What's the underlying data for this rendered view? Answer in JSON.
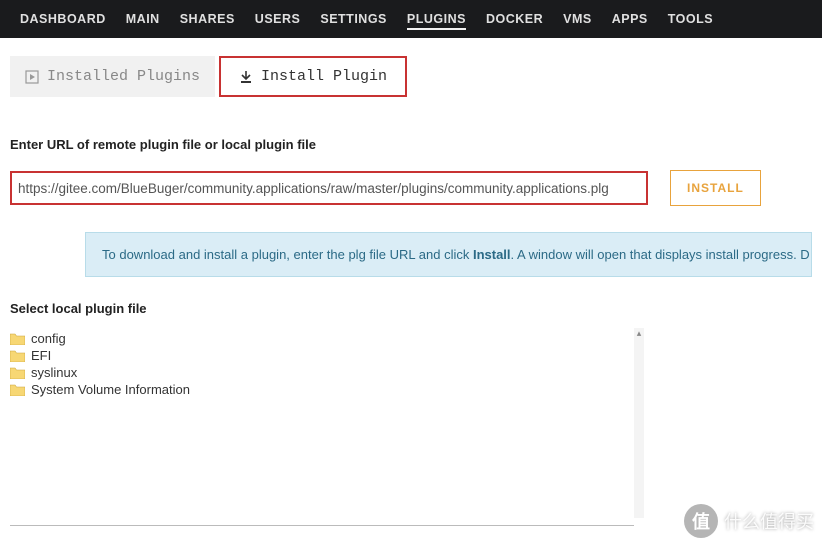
{
  "nav": {
    "items": [
      {
        "label": "DASHBOARD",
        "active": false
      },
      {
        "label": "MAIN",
        "active": false
      },
      {
        "label": "SHARES",
        "active": false
      },
      {
        "label": "USERS",
        "active": false
      },
      {
        "label": "SETTINGS",
        "active": false
      },
      {
        "label": "PLUGINS",
        "active": true
      },
      {
        "label": "DOCKER",
        "active": false
      },
      {
        "label": "VMS",
        "active": false
      },
      {
        "label": "APPS",
        "active": false
      },
      {
        "label": "TOOLS",
        "active": false
      }
    ]
  },
  "tabs": {
    "installed": {
      "label": "Installed Plugins"
    },
    "install": {
      "label": "Install Plugin"
    }
  },
  "form": {
    "url_label": "Enter URL of remote plugin file or local plugin file",
    "url_value": "https://gitee.com/BlueBuger/community.applications/raw/master/plugins/community.applications.plg",
    "install_button": "INSTALL"
  },
  "info": {
    "pre": "To download and install a plugin, enter the plg file URL and click ",
    "bold": "Install",
    "post": ". A window will open that displays install progress. D"
  },
  "filetree": {
    "label": "Select local plugin file",
    "items": [
      {
        "name": "config"
      },
      {
        "name": "EFI"
      },
      {
        "name": "syslinux"
      },
      {
        "name": "System Volume Information"
      }
    ]
  },
  "watermark": {
    "badge": "值",
    "text": "什么值得买"
  },
  "colors": {
    "highlight_red": "#c83232",
    "accent_orange": "#e8a33d",
    "nav_bg": "#1a1b1d",
    "info_bg": "#daedf6",
    "info_text": "#2b6a86"
  }
}
